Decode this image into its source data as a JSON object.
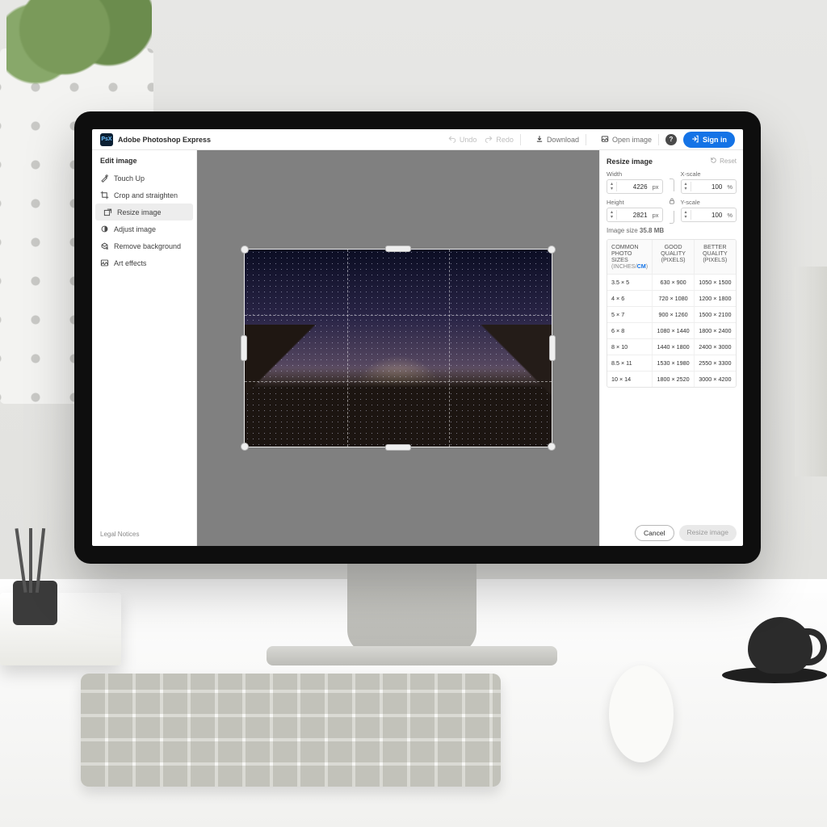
{
  "app": {
    "title": "Adobe Photoshop Express",
    "logo_text": "PsX"
  },
  "topbar": {
    "undo": "Undo",
    "redo": "Redo",
    "download": "Download",
    "open_image": "Open image",
    "signin": "Sign in"
  },
  "sidebar": {
    "title": "Edit image",
    "items": [
      {
        "label": "Touch Up"
      },
      {
        "label": "Crop and straighten"
      },
      {
        "label": "Resize image"
      },
      {
        "label": "Adjust image"
      },
      {
        "label": "Remove background"
      },
      {
        "label": "Art effects"
      }
    ],
    "footer": "Legal Notices"
  },
  "panel": {
    "title": "Resize image",
    "reset": "Reset",
    "width_label": "Width",
    "height_label": "Height",
    "xscale_label": "X-scale",
    "yscale_label": "Y-scale",
    "width_value": "4226",
    "width_unit": "px",
    "height_value": "2821",
    "height_unit": "px",
    "xscale_value": "100",
    "xscale_unit": "%",
    "yscale_value": "100",
    "yscale_unit": "%",
    "image_size_label": "Image size",
    "image_size_value": "35.8 MB",
    "table": {
      "hdr_common_l1": "COMMON",
      "hdr_common_l2": "PHOTO SIZES",
      "hdr_common_units_inches": "INCHES",
      "hdr_common_units_sep": "/",
      "hdr_common_units_cm": "CM",
      "hdr_good_l1": "GOOD",
      "hdr_good_l2": "QUALITY",
      "hdr_good_l3": "(PIXELS)",
      "hdr_better_l1": "BETTER",
      "hdr_better_l2": "QUALITY",
      "hdr_better_l3": "(PIXELS)",
      "rows": [
        {
          "size": "3.5 × 5",
          "good": "630 × 900",
          "better": "1050 × 1500"
        },
        {
          "size": "4 × 6",
          "good": "720 × 1080",
          "better": "1200 × 1800"
        },
        {
          "size": "5 × 7",
          "good": "900 × 1260",
          "better": "1500 × 2100"
        },
        {
          "size": "6 × 8",
          "good": "1080 × 1440",
          "better": "1800 × 2400"
        },
        {
          "size": "8 × 10",
          "good": "1440 × 1800",
          "better": "2400 × 3000"
        },
        {
          "size": "8.5 × 11",
          "good": "1530 × 1980",
          "better": "2550 × 3300"
        },
        {
          "size": "10 × 14",
          "good": "1800 × 2520",
          "better": "3000 × 4200"
        }
      ]
    },
    "cancel": "Cancel",
    "apply": "Resize image"
  }
}
